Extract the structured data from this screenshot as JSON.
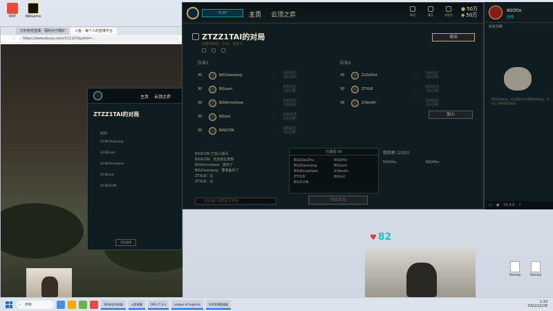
{
  "desktop": {
    "icons": [
      {
        "label": "WKT",
        "color": "#e64a3b"
      },
      {
        "label": "WeGame",
        "color": "#111111"
      }
    ],
    "files": [
      {
        "label": "Desktop"
      },
      {
        "label": "Desktop"
      }
    ]
  },
  "browser": {
    "tabs": [
      "万利电竞直播 - 福利大厅精彩",
      "斗鱼 - 每个人的直播平台"
    ],
    "url": "https://www.douyu.com/11111?dyshid=..."
  },
  "client": {
    "play_label": "PLAY",
    "nav": [
      "主页",
      "云顶之弈"
    ],
    "top_icons": [
      "商店",
      "藏品",
      "战利品"
    ],
    "currency": {
      "be": "50万",
      "rp": "50万"
    },
    "lobby_title": "ZTZZ1TAI的对局",
    "lobby_sub": "召唤师峡谷 · 5V5 · 自定义",
    "leave_label": "退出",
    "team1_label": "队伍1",
    "team2_label": "队伍2",
    "team1": [
      {
        "level": "30",
        "name": "BIGXiaoxiang",
        "rank": "-",
        "pos": "没有段位\n(段位赛)",
        "pos_val": "0"
      },
      {
        "level": "30",
        "name": "BIGsam",
        "rank": "-",
        "pos": "没有段位\n(段位赛)",
        "pos_val": "0"
      },
      {
        "level": "30",
        "name": "BIGAmvalleee",
        "rank": "-",
        "pos": "没有段位\n(段位赛)",
        "pos_val": "0"
      },
      {
        "level": "30",
        "name": "BIGizd",
        "rank": "-",
        "pos": "没有段位\n(段位赛)",
        "pos_val": "0"
      },
      {
        "level": "30",
        "name": "BIGICON",
        "rank": "-",
        "pos": "没有段位\n(段位赛)",
        "pos_val": "0"
      }
    ],
    "team2": [
      {
        "level": "30",
        "name": "ZzZxDiot",
        "rank": "-",
        "pos": "没有段位\n(段位赛)",
        "pos_val": "0"
      },
      {
        "level": "30",
        "name": "ZTXLB",
        "rank": "-",
        "pos": "没有段位\n(段位赛)",
        "pos_val": "0"
      },
      {
        "level": "30",
        "name": "ZiYandih",
        "rank": "-",
        "pos": "没有段位\n(段位赛)",
        "pos_val": "0"
      }
    ],
    "join_label": "加入",
    "chat": [
      "BIGICON 已加入房间",
      "BIGICON：欢迎各位老板",
      "BIGAmvalleee：搞好了",
      "BIGXiaoxiang：要准备好了",
      "ZTXLB：😊",
      "ZTXLB：😊"
    ],
    "chat_placeholder": "在此输入消息进行对话",
    "invited_header": "已邀请 (8)",
    "invited": [
      "BIGXiaoZhu",
      "NSOHto",
      "BIGXiaoxiang",
      "BIGsam",
      "BIGAmvalleee",
      "ZiYandih",
      "ZTXLB",
      "BIGizd",
      "BIGICON",
      ""
    ],
    "spectators_header": "观战者 (2/20)",
    "spectators": [
      "NSOHto",
      "NSOHto"
    ],
    "start_label": "开始游戏"
  },
  "social": {
    "name": "NSOtto",
    "status": "在线",
    "header": "好友列表",
    "empty_text": "您还没有好友。在这里你可以看到你的好友，点击上方按钮添加好友",
    "version": "V1.5.0"
  },
  "mini_client": {
    "nav": [
      "主页",
      "云顶之弈"
    ],
    "title": "ZTZZ1TAI的对局",
    "team_label": "队伍1",
    "rows": [
      "30  BIGXiaoxiang",
      "30  BIGsam",
      "30  BIGAmvalleee",
      "30  BIGizd",
      "30  BIGICON"
    ],
    "start_label": "开始游戏"
  },
  "overlay": {
    "likes": "82"
  },
  "taskbar": {
    "search": "搜索",
    "apps": [
      "360安全浏览器",
      "斗鱼直播",
      "OBS 27.2.4",
      "League of Legends",
      "文件资源管理器"
    ],
    "time": "1:33",
    "date": "2022/12/29"
  }
}
